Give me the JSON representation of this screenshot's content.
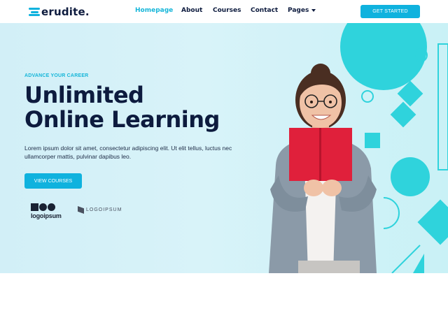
{
  "header": {
    "logo_text": "erudite.",
    "nav": {
      "home": "Homepage",
      "about": "About",
      "courses": "Courses",
      "contact": "Contact",
      "pages": "Pages"
    },
    "cta_label": "GET STARTED"
  },
  "hero": {
    "eyebrow": "ADVANCE YOUR CAREER",
    "title_line1": "Unlimited",
    "title_line2": "Online Learning",
    "description": "Lorem ipsum dolor sit amet, consectetur adipiscing elit. Ut elit tellus, luctus nec ullamcorper mattis, pulvinar dapibus leo.",
    "button_label": "VIEW COURSES",
    "partners": {
      "logo1_text": "logoipsum",
      "logo2_text": "LOGOIPSUM"
    }
  },
  "colors": {
    "accent": "#0fb2de",
    "heading": "#0d1b3e",
    "hero_bg": "#d2eff7",
    "shape_teal": "#2fd3dc"
  },
  "icons": {
    "logo_mark": "stacked-bars-logo-icon",
    "pages_dropdown": "chevron-down-icon"
  }
}
